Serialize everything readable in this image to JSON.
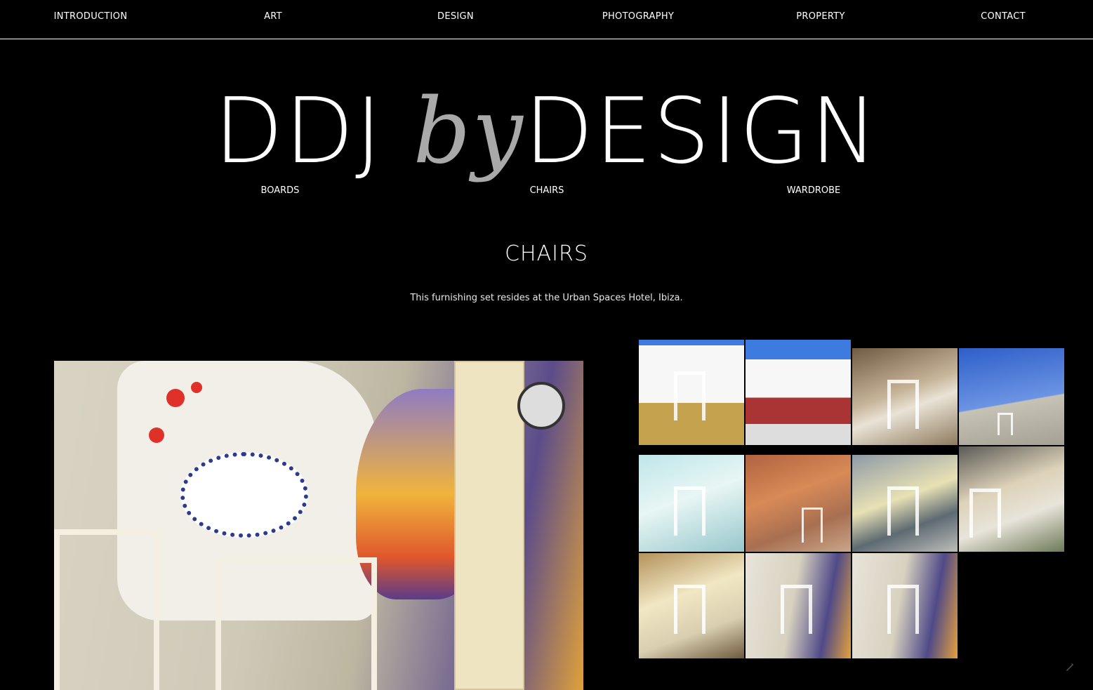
{
  "nav": {
    "items": [
      {
        "label": "INTRODUCTION"
      },
      {
        "label": "ART"
      },
      {
        "label": "DESIGN"
      },
      {
        "label": "PHOTOGRAPHY"
      },
      {
        "label": "PROPERTY"
      },
      {
        "label": "CONTACT"
      }
    ]
  },
  "logo": {
    "part1": "DDJ",
    "part2": "by",
    "part3": "DESIGN"
  },
  "subnav": {
    "items": [
      {
        "label": "BOARDS"
      },
      {
        "label": "CHAIRS"
      },
      {
        "label": "WARDROBE"
      }
    ]
  },
  "section": {
    "title": "CHAIRS",
    "description": "This furnishing set resides at the Urban Spaces Hotel, Ibiza."
  },
  "gallery": {
    "thumb_count": 11,
    "thumb_icons": [
      "photo-thumbnail"
    ]
  },
  "colors": {
    "background": "#000000",
    "text": "#ffffff",
    "logo_accent": "#a9a9a9"
  }
}
